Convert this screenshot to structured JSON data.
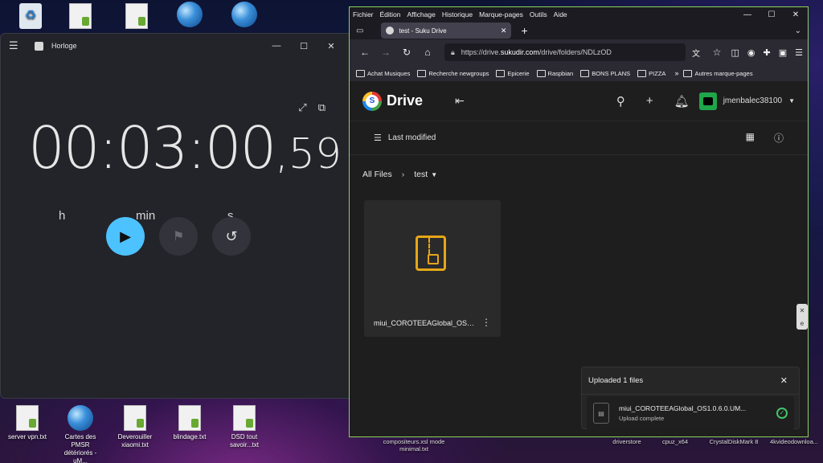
{
  "desktop": {
    "bottom_icons": [
      {
        "label": "server vpn.txt",
        "type": "doc"
      },
      {
        "label": "Cartes des PMSR détériorés - uM...",
        "type": "globe"
      },
      {
        "label": "Deverouiller xiaomi.txt",
        "type": "doc"
      },
      {
        "label": "blindage.txt",
        "type": "doc"
      },
      {
        "label": "DSD tout savoir...txt",
        "type": "doc"
      }
    ],
    "partial_labels": [
      "compositeurs.xsl mode minimal.txt",
      "driverstore",
      "cpuz_x64",
      "CrystalDiskMark 8",
      "4kvideodownloa..."
    ]
  },
  "clock": {
    "title": "Horloge",
    "timer_main": "00:03:00",
    "timer_frac": ",59",
    "units": {
      "h": "h",
      "min": "min",
      "s": "s"
    }
  },
  "firefox": {
    "menu": [
      "Fichier",
      "Édition",
      "Affichage",
      "Historique",
      "Marque-pages",
      "Outils",
      "Aide"
    ],
    "tab_title": "test - Suku Drive",
    "url_prefix": "https://drive.",
    "url_domain": "sukudir.com",
    "url_path": "/drive/folders/NDLzOD",
    "bookmarks": [
      "Achat Musiques",
      "Recherche newgroups",
      "Epicerie",
      "Raspbian",
      "BONS PLANS",
      "PIZZA"
    ],
    "bookmarks_more": "»",
    "bookmarks_other": "Autres marque-pages"
  },
  "drive": {
    "app_name": "Drive",
    "logo_letter": "S",
    "username": "jmenbalec38100",
    "sort_label": "Last modified",
    "breadcrumb_root": "All Files",
    "breadcrumb_current": "test",
    "files": [
      {
        "name": "miui_COROTEEAGlobal_OS1.0.6.0.UM..."
      }
    ],
    "upload": {
      "title": "Uploaded 1 files",
      "file_name": "miui_COROTEEAGlobal_OS1.0.6.0.UM...",
      "status": "Upload complete"
    }
  }
}
